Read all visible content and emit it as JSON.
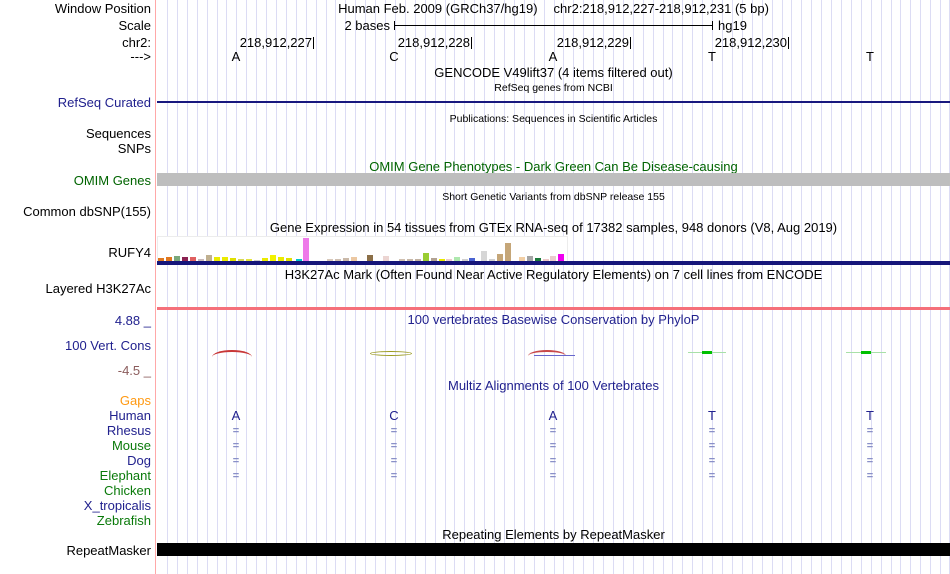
{
  "colors": {
    "grid": "#dcdcf4",
    "separator": "#ffa8a8",
    "navy_text": "#21218e",
    "green_text": "#006400",
    "orange_text": "#ff9912",
    "maroon_text": "#8b5c5c",
    "refseq_line": "#18187e",
    "omim_bar": "#bebebe",
    "gtex_baseline": "#16167a",
    "h3k27ac_line": "#f5707a",
    "repeat_bar": "#000000",
    "align_eq": "#8a90c8"
  },
  "header": {
    "window_position_label": "Window Position",
    "assembly_title": "Human Feb. 2009 (GRCh37/hg19)",
    "range_title": "chr2:218,912,227-218,912,231 (5 bp)",
    "scale_label": "Scale",
    "scale_value": "2 bases",
    "genome": "hg19",
    "chrom_label": "chr2:",
    "strand_label": "--->",
    "coordinates": [
      {
        "text": "218,912,227",
        "tick_x": 314
      },
      {
        "text": "218,912,228",
        "tick_x": 472
      },
      {
        "text": "218,912,229",
        "tick_x": 631
      },
      {
        "text": "218,912,230",
        "tick_x": 789
      }
    ],
    "bases": [
      "A",
      "C",
      "A",
      "T",
      "T"
    ],
    "base_x": [
      236,
      394,
      553,
      712,
      870
    ]
  },
  "tracks": {
    "gencode": {
      "title": "GENCODE V49lift37 (4 items filtered out)",
      "subtitle": "RefSeq genes from NCBI",
      "label": "RefSeq Curated"
    },
    "publications": {
      "title": "Publications: Sequences in Scientific Articles",
      "label_sequences": "Sequences",
      "label_snps": "SNPs"
    },
    "omim": {
      "title": "OMIM Gene Phenotypes - Dark Green Can Be Disease-causing",
      "label": "OMIM Genes"
    },
    "dbsnp": {
      "title": "Short Genetic Variants from dbSNP release 155",
      "label": "Common dbSNP(155)"
    },
    "gtex": {
      "title": "Gene Expression in 54 tissues from GTEx RNA-seq of 17382 samples, 948 donors (V8, Aug 2019)",
      "label": "RUFY4"
    },
    "h3k27ac": {
      "title": "H3K27Ac Mark (Often Found Near Active Regulatory Elements) on 7 cell lines from ENCODE",
      "label": "Layered H3K27Ac"
    },
    "phylop": {
      "title": "100 vertebrates Basewise Conservation by PhyloP",
      "label": "100 Vert. Cons",
      "max_label": "4.88 _",
      "min_label": "-4.5 _"
    },
    "multiz": {
      "title": "Multiz Alignments of 100 Vertebrates"
    },
    "repeatmasker": {
      "title": "Repeating Elements by RepeatMasker",
      "label": "RepeatMasker"
    }
  },
  "chart_data": {
    "gtex_expression": {
      "type": "bar",
      "title": "Gene Expression in 54 tissues from GTEx RNA-seq of 17382 samples, 948 donors (V8, Aug 2019)",
      "gene": "RUFY4",
      "note": "bars in screen px, baseline at y=261",
      "bars": [
        {
          "x": 158,
          "h": 3,
          "color": "#e07820"
        },
        {
          "x": 166,
          "h": 4,
          "color": "#e07820"
        },
        {
          "x": 174,
          "h": 5,
          "color": "#7aa87a"
        },
        {
          "x": 182,
          "h": 4,
          "color": "#8b2252"
        },
        {
          "x": 190,
          "h": 4,
          "color": "#e06060"
        },
        {
          "x": 198,
          "h": 2,
          "color": "#c8b8b8"
        },
        {
          "x": 206,
          "h": 6,
          "color": "#c0b090"
        },
        {
          "x": 214,
          "h": 4,
          "color": "#ebeb00"
        },
        {
          "x": 222,
          "h": 4,
          "color": "#ebeb00"
        },
        {
          "x": 230,
          "h": 3,
          "color": "#e0e000"
        },
        {
          "x": 238,
          "h": 2,
          "color": "#d8d855"
        },
        {
          "x": 246,
          "h": 2,
          "color": "#e3e340"
        },
        {
          "x": 254,
          "h": 1,
          "color": "#cccccc"
        },
        {
          "x": 262,
          "h": 3,
          "color": "#ebeb00"
        },
        {
          "x": 270,
          "h": 6,
          "color": "#f2f200"
        },
        {
          "x": 278,
          "h": 4,
          "color": "#ebeb00"
        },
        {
          "x": 286,
          "h": 3,
          "color": "#e0e000"
        },
        {
          "x": 296,
          "h": 2,
          "color": "#00c5cd"
        },
        {
          "x": 303,
          "h": 23,
          "color": "#ee7ae9"
        },
        {
          "x": 327,
          "h": 2,
          "color": "#d8c8ba"
        },
        {
          "x": 335,
          "h": 2,
          "color": "#d0c0b2"
        },
        {
          "x": 343,
          "h": 3,
          "color": "#cab9a9"
        },
        {
          "x": 351,
          "h": 4,
          "color": "#ecc8a2"
        },
        {
          "x": 367,
          "h": 6,
          "color": "#8b6f47"
        },
        {
          "x": 383,
          "h": 5,
          "color": "#ecd5d2"
        },
        {
          "x": 399,
          "h": 2,
          "color": "#d0c0b0"
        },
        {
          "x": 407,
          "h": 2,
          "color": "#c8b8a8"
        },
        {
          "x": 415,
          "h": 2,
          "color": "#c2b2a2"
        },
        {
          "x": 423,
          "h": 8,
          "color": "#9acd32"
        },
        {
          "x": 431,
          "h": 3,
          "color": "#b2a292"
        },
        {
          "x": 439,
          "h": 2,
          "color": "#e8e800"
        },
        {
          "x": 446,
          "h": 2,
          "color": "#eccccc"
        },
        {
          "x": 454,
          "h": 4,
          "color": "#aee8ae"
        },
        {
          "x": 462,
          "h": 2,
          "color": "#cfcfcf"
        },
        {
          "x": 469,
          "h": 3,
          "color": "#4a63d2"
        },
        {
          "x": 481,
          "h": 10,
          "color": "#d6d6d6"
        },
        {
          "x": 489,
          "h": 2,
          "color": "#d0d0d0"
        },
        {
          "x": 497,
          "h": 7,
          "color": "#c5a678"
        },
        {
          "x": 505,
          "h": 18,
          "color": "#c5a678"
        },
        {
          "x": 519,
          "h": 4,
          "color": "#f2cfa5"
        },
        {
          "x": 527,
          "h": 5,
          "color": "#a5a5a5"
        },
        {
          "x": 535,
          "h": 3,
          "color": "#1a7a3a"
        },
        {
          "x": 543,
          "h": 2,
          "color": "#ecc9c9"
        },
        {
          "x": 550,
          "h": 5,
          "color": "#e9cccc"
        },
        {
          "x": 558,
          "h": 7,
          "color": "#f000f0"
        }
      ]
    },
    "phylop_conservation": {
      "type": "line",
      "title": "100 vertebrates Basewise Conservation by PhyloP",
      "ylim": [
        -4.5,
        4.88
      ],
      "marks": [
        {
          "kind": "arc",
          "x": 212,
          "w": 40,
          "color": "#c83737"
        },
        {
          "kind": "ellipse",
          "x": 370,
          "w": 42,
          "color": "#9a9a20"
        },
        {
          "kind": "arc2",
          "x": 528,
          "w": 47,
          "color": "#c84848",
          "color2": "#6666cc"
        },
        {
          "kind": "gline",
          "x": 688,
          "w": 38,
          "color": "#a8e0a8",
          "dash": "#00c000"
        },
        {
          "kind": "gline",
          "x": 846,
          "w": 40,
          "color": "#a8e0a8",
          "dash": "#00c000"
        }
      ]
    },
    "multiz_alignment": {
      "type": "table",
      "title": "Multiz Alignments of 100 Vertebrates",
      "columns": [
        "A",
        "C",
        "A",
        "T",
        "T"
      ],
      "rows": [
        {
          "label": "Gaps",
          "color": "#ff9912",
          "cells": [
            "",
            "",
            "",
            "",
            ""
          ]
        },
        {
          "label": "Human",
          "color": "#21218e",
          "cells": [
            "A",
            "C",
            "A",
            "T",
            "T"
          ]
        },
        {
          "label": "Rhesus",
          "color": "#21218e",
          "cells": [
            "=",
            "=",
            "=",
            "=",
            "="
          ]
        },
        {
          "label": "Mouse",
          "color": "#0a7a0a",
          "cells": [
            "=",
            "=",
            "=",
            "=",
            "="
          ]
        },
        {
          "label": "Dog",
          "color": "#21218e",
          "cells": [
            "=",
            "=",
            "=",
            "=",
            "="
          ]
        },
        {
          "label": "Elephant",
          "color": "#0a7a0a",
          "cells": [
            "=",
            "=",
            "=",
            "=",
            "="
          ]
        },
        {
          "label": "Chicken",
          "color": "#0a7a0a",
          "cells": [
            "",
            "",
            "",
            "",
            ""
          ]
        },
        {
          "label": "X_tropicalis",
          "color": "#21218e",
          "cells": [
            "",
            "",
            "",
            "",
            ""
          ]
        },
        {
          "label": "Zebrafish",
          "color": "#0a7a0a",
          "cells": [
            "",
            "",
            "",
            "",
            ""
          ]
        }
      ]
    }
  }
}
